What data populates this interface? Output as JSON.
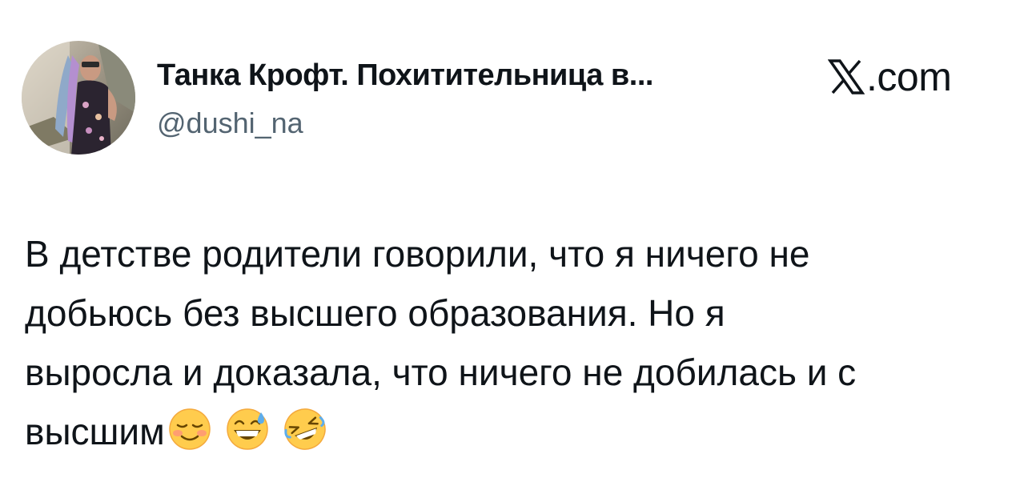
{
  "author": {
    "display_name": "Танка Крофт. Похитительница в...",
    "handle": "@dushi_na",
    "avatar_icon": "user-avatar-photo"
  },
  "brand": {
    "logo_icon": "x-logo-icon",
    "suffix": ".com"
  },
  "tweet": {
    "lines": [
      "В детстве родители говорили, что я ничего не",
      "добьюсь без высшего образования. Но я",
      "выросла и доказала, что ничего не добилась и с",
      "высшим"
    ],
    "emojis": [
      "smiling-face-emoji",
      "grinning-sweat-emoji",
      "rolling-laughing-emoji"
    ]
  },
  "colors": {
    "text": "#0f1419",
    "secondary_text": "#536471",
    "background": "#ffffff",
    "emoji_yellow": "#ffcc4d"
  }
}
